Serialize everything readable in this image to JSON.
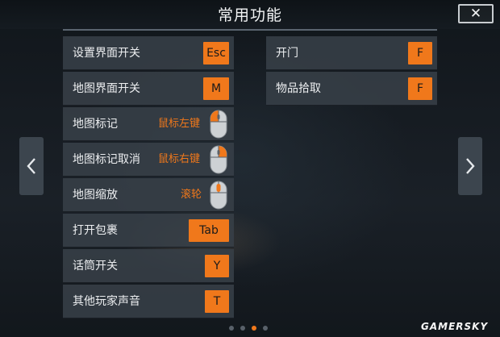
{
  "header": {
    "title": "常用功能",
    "close_label": "✕"
  },
  "nav": {
    "prev_icon": "chevron-left-icon",
    "next_icon": "chevron-right-icon"
  },
  "left_column": [
    {
      "label": "设置界面开关",
      "key": "Esc"
    },
    {
      "label": "地图界面开关",
      "key": "M"
    },
    {
      "label": "地图标记",
      "mouse_text": "鼠标左键",
      "mouse_icon": "mouse-left-button-icon"
    },
    {
      "label": "地图标记取消",
      "mouse_text": "鼠标右键",
      "mouse_icon": "mouse-right-button-icon"
    },
    {
      "label": "地图缩放",
      "mouse_text": "滚轮",
      "mouse_icon": "mouse-wheel-icon"
    },
    {
      "label": "打开包裹",
      "key": "Tab"
    },
    {
      "label": "话筒开关",
      "key": "Y"
    },
    {
      "label": "其他玩家声音",
      "key": "T"
    }
  ],
  "right_column": [
    {
      "label": "开门",
      "key": "F"
    },
    {
      "label": "物品拾取",
      "key": "F"
    }
  ],
  "pagination": {
    "total": 4,
    "active_index": 2
  },
  "watermark": "GAMERSKY",
  "colors": {
    "accent": "#f0781b",
    "row_bg": "#384048",
    "background": "#141a20"
  }
}
